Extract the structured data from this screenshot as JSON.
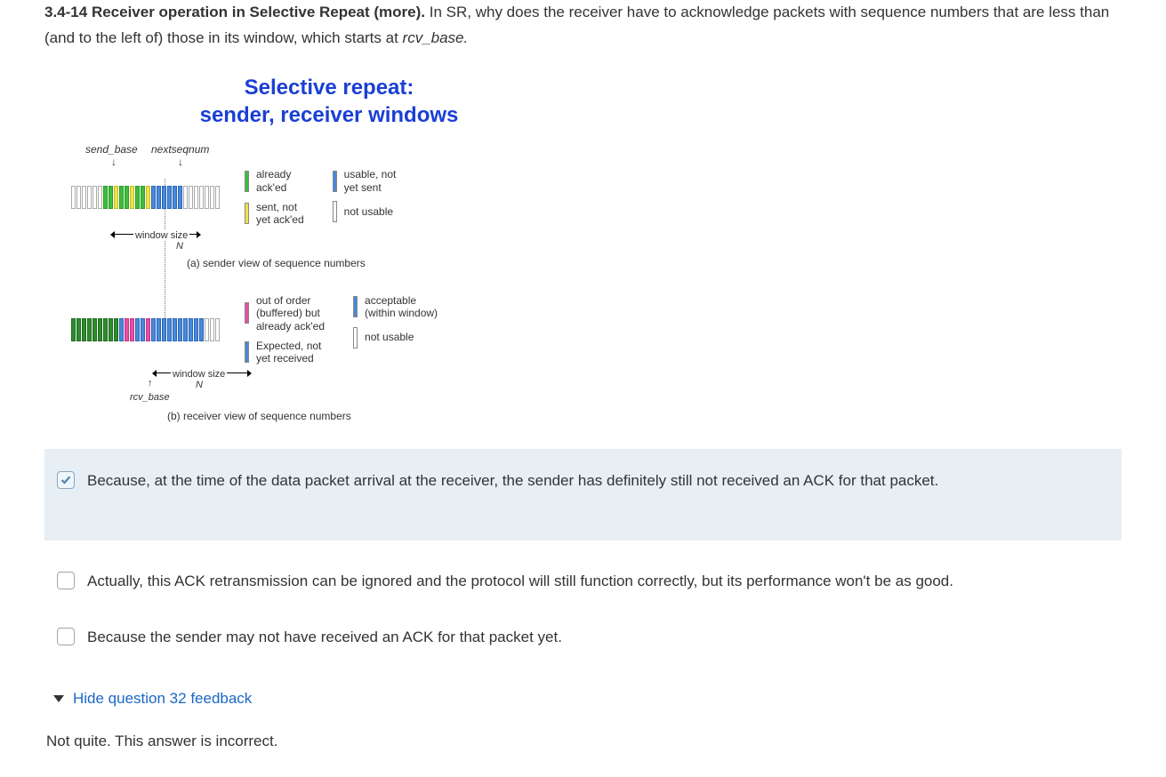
{
  "question": {
    "number": "3.4-14",
    "title": "Receiver operation in Selective Repeat (more).",
    "body_before_italic": " In SR, why does the receiver have to acknowledge packets with sequence numbers that are less than (and to the left of) those in its window, which starts at ",
    "italic_term": "rcv_base.",
    "body_after_italic": ""
  },
  "diagram": {
    "title_line1": "Selective repeat:",
    "title_line2": "sender, receiver windows",
    "sender": {
      "send_base_label": "send_base",
      "nextseqnum_label": "nextseqnum",
      "window_label": "window size",
      "window_N": "N",
      "caption": "(a) sender view of sequence numbers",
      "slots": [
        "plain",
        "plain",
        "plain",
        "plain",
        "plain",
        "plain",
        "green",
        "green",
        "yellow",
        "green",
        "green",
        "yellow",
        "green",
        "green",
        "yellow",
        "blue",
        "blue",
        "blue",
        "blue",
        "blue",
        "blue",
        "plain",
        "plain",
        "plain",
        "plain",
        "plain",
        "plain",
        "plain"
      ]
    },
    "receiver": {
      "window_label": "window size",
      "window_N": "N",
      "rcv_base_label": "rcv_base",
      "caption": "(b) receiver view of sequence numbers",
      "slots": [
        "greenD",
        "greenD",
        "greenD",
        "greenD",
        "greenD",
        "greenD",
        "greenD",
        "greenD",
        "greenD",
        "blue",
        "pink",
        "pink",
        "blue",
        "blue",
        "pink",
        "blue",
        "blue",
        "blue",
        "blue",
        "blue",
        "blue",
        "blue",
        "blue",
        "blue",
        "blue",
        "plain",
        "plain",
        "plain"
      ]
    },
    "legend_sender": {
      "already_acked": "already\nack'ed",
      "sent_not_acked": "sent, not\nyet ack'ed",
      "usable_not_sent": "usable, not\nyet sent",
      "not_usable": "not usable"
    },
    "legend_receiver": {
      "out_of_order": "out of order\n(buffered) but\nalready ack'ed",
      "expected": "Expected, not\nyet received",
      "acceptable": "acceptable\n(within window)",
      "not_usable": "not usable"
    }
  },
  "options": [
    {
      "text": "Because, at the time of the data packet arrival at the receiver, the sender has definitely still not received an ACK for that packet.",
      "checked": true,
      "highlighted": true
    },
    {
      "text": "Actually, this ACK retransmission can be ignored and the protocol will still function correctly, but its performance won't be as good.",
      "checked": false,
      "highlighted": false
    },
    {
      "text": "Because the sender may not have received an ACK for that packet yet.",
      "checked": false,
      "highlighted": false
    }
  ],
  "feedback": {
    "toggle_label": "Hide question 32 feedback",
    "text": "Not quite. This answer is incorrect."
  }
}
